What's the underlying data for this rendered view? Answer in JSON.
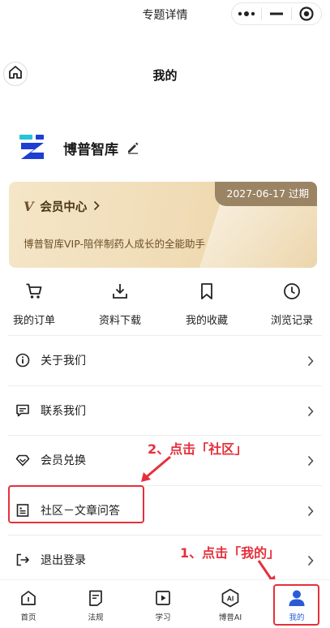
{
  "topbar": {
    "title": "专题详情",
    "capsule": {
      "more_icon": "more-dots-icon",
      "minimize_icon": "minimize-icon",
      "close_icon": "target-close-icon"
    }
  },
  "navbar": {
    "title": "我的",
    "home_icon": "home-icon"
  },
  "profile": {
    "name": "博普智库",
    "logo_icon": "brand-logo-icon",
    "edit_icon": "pencil-icon"
  },
  "vip": {
    "expire": "2027-06-17 过期",
    "v_mark": "V",
    "center_label": "会员中心",
    "desc": "博普智库VIP-陪伴制药人成长的全能助手"
  },
  "shortcuts": [
    {
      "label": "我的订单",
      "icon": "cart-icon"
    },
    {
      "label": "资料下载",
      "icon": "download-icon"
    },
    {
      "label": "我的收藏",
      "icon": "bookmark-icon"
    },
    {
      "label": "浏览记录",
      "icon": "clock-icon"
    }
  ],
  "menu": [
    {
      "label": "关于我们",
      "icon": "info-icon"
    },
    {
      "label": "联系我们",
      "icon": "message-icon"
    },
    {
      "label": "会员兑换",
      "icon": "diamond-icon"
    },
    {
      "label": "社区－文章问答",
      "icon": "document-icon"
    },
    {
      "label": "退出登录",
      "icon": "logout-icon"
    }
  ],
  "annotations": {
    "step2": "2、点击「社区」",
    "step1": "1、点击「我的」"
  },
  "tabs": [
    {
      "label": "首页",
      "icon": "home-tab-icon"
    },
    {
      "label": "法规",
      "icon": "regulation-icon"
    },
    {
      "label": "学习",
      "icon": "play-icon"
    },
    {
      "label": "博普AI",
      "icon": "ai-hexagon-icon",
      "ai_text": "AI"
    },
    {
      "label": "我的",
      "icon": "user-icon",
      "active": true
    }
  ],
  "colors": {
    "accent": "#2a5bd7",
    "annotation": "#e5303c",
    "vip_badge": "#9a8463"
  }
}
